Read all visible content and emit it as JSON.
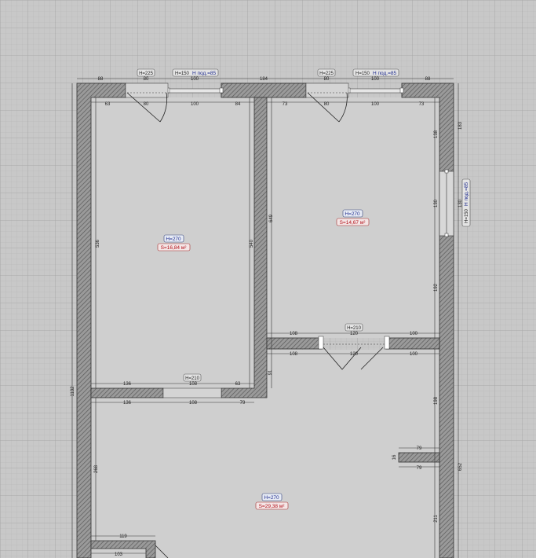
{
  "colors": {
    "background": "#c8c8c8",
    "grid_minor": "#b8b8b8",
    "grid_major": "#a8a8a8",
    "wall_hatch": "#6b6b6b",
    "room_fill": "#cfcfcf",
    "height_tag": "#1d2a8c",
    "area_tag": "#b3121b"
  },
  "rooms": [
    {
      "height": "H=270",
      "area": "S=16,84 м²"
    },
    {
      "height": "H=270",
      "area": "S=14,67 м²"
    },
    {
      "height": "H=270",
      "area": "S=29,38 м²"
    }
  ],
  "tags": {
    "door1_h": "H=225",
    "win1_h": "H=150",
    "win1_sill": "H под.=85",
    "door2_h": "H=225",
    "win2_h": "H=150",
    "win2_sill": "H под.=85",
    "side_win_h": "H=150",
    "side_win_sill": "H под.=85",
    "inner_door1": "H=210",
    "inner_door2": "H=210"
  },
  "dims": {
    "top_88_left": "88",
    "top_80_a": "80",
    "top_100_a": "100",
    "top_184": "184",
    "top_80_b": "80",
    "top_100_b": "100",
    "top_88_right": "88",
    "r1_63": "63",
    "r1_80": "80",
    "r1_100": "100",
    "r1_84": "84",
    "r2_73a": "73",
    "r2_80": "80",
    "r2_100": "100",
    "r2_73b": "73",
    "left_536": "536",
    "left_1132": "1132",
    "mid_540": "540",
    "mid_649": "649",
    "mid_91": "91",
    "r1_b_136": "136",
    "r1_b_108": "108",
    "r1_b_63": "63",
    "r3_t_136": "136",
    "r3_t_108": "108",
    "r3_t_79": "79",
    "r2_right_138": "138",
    "r2_right_130": "130",
    "r2_right_192": "192",
    "outer_183": "183",
    "outer_130": "130",
    "outer_652": "652",
    "r2_b_108": "108",
    "r2_b_120": "120",
    "r2_b_100": "100",
    "r3_t2_108": "108",
    "r3_t2_120": "120",
    "r3_t2_100": "100",
    "r3_right_198": "198",
    "r3_right_211": "211",
    "stub_79a": "79",
    "stub_16": "16",
    "stub_79b": "79",
    "r3_left_268": "268",
    "bot_119": "119",
    "bot_103": "103"
  }
}
